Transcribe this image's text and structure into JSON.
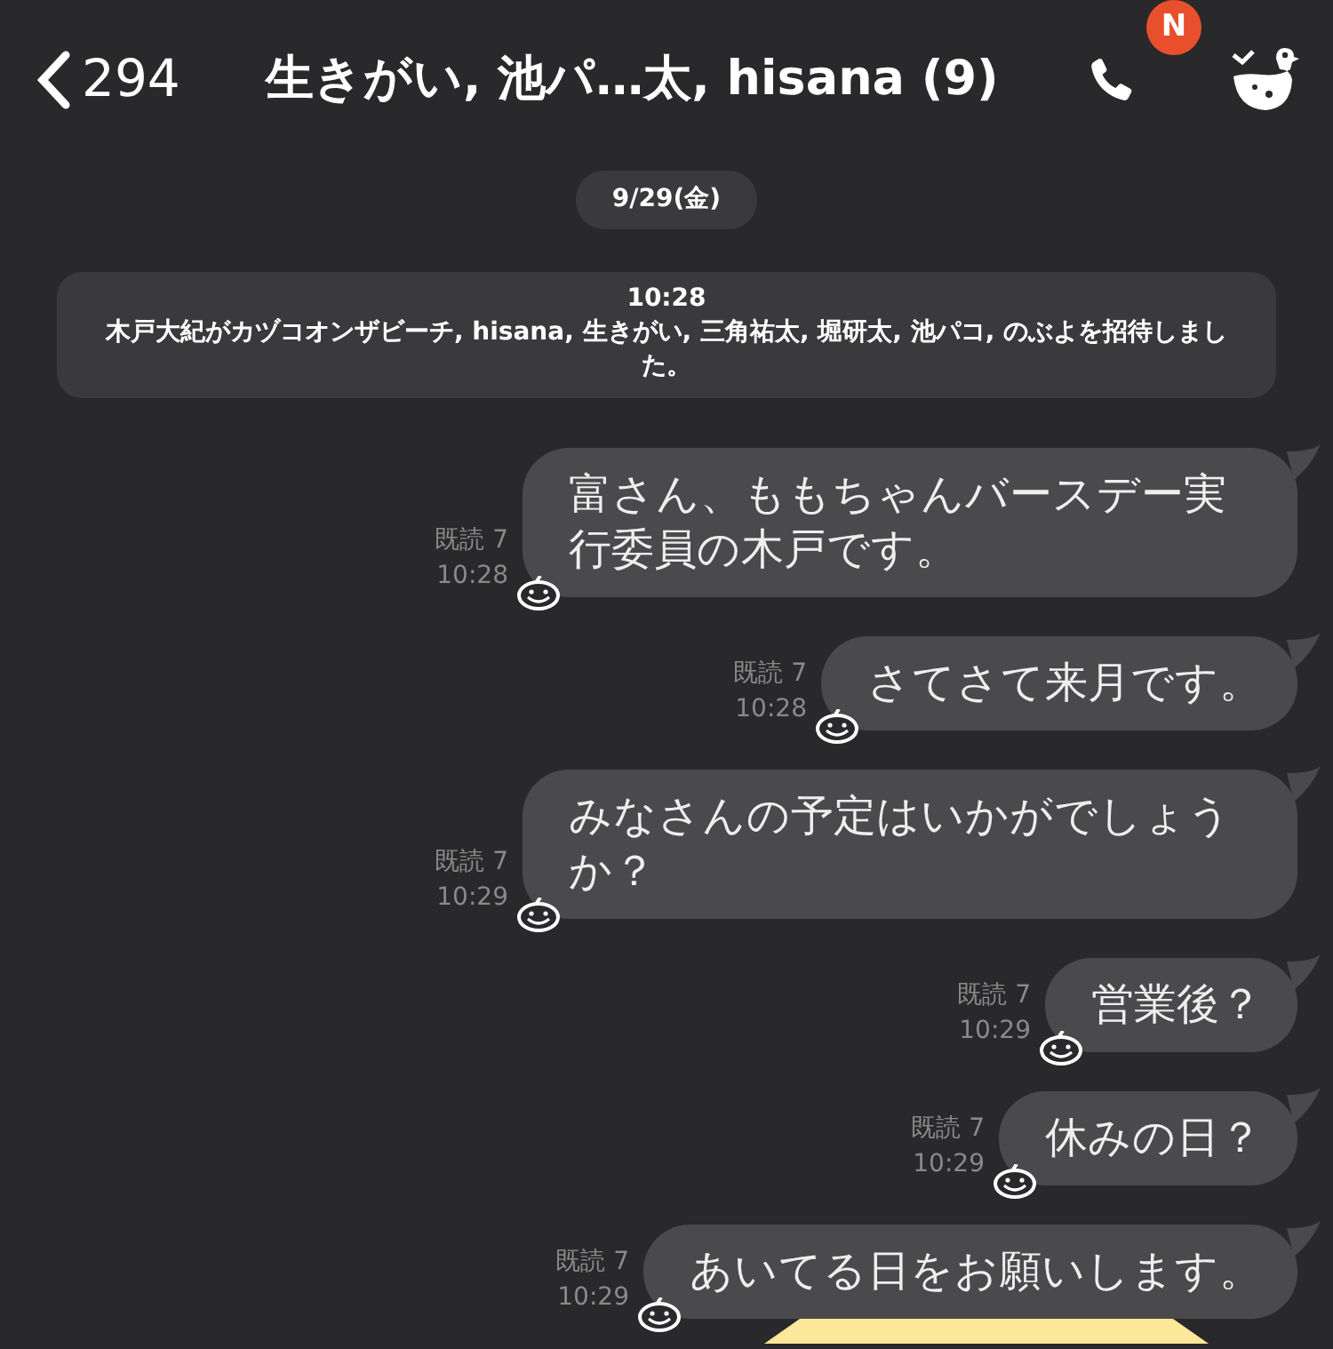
{
  "header": {
    "back_count": "294",
    "title": "生きがい, 池パ…太, hisana (9)",
    "call_badge": "N"
  },
  "date_chip": "9/29(金)",
  "system_message": {
    "time": "10:28",
    "text": "木戸大紀がカヅコオンザビーチ, hisana, 生きがい, 三角祐太, 堀研太, 池パコ, のぶよを招待しました。"
  },
  "messages": [
    {
      "text": "富さん、ももちゃんバースデー実行委員の木戸です。",
      "read": "既読 7",
      "time": "10:28"
    },
    {
      "text": "さてさて来月です。",
      "read": "既読 7",
      "time": "10:28"
    },
    {
      "text": "みなさんの予定はいかがでしょうか？",
      "read": "既読 7",
      "time": "10:29"
    },
    {
      "text": "営業後？",
      "read": "既読 7",
      "time": "10:29"
    },
    {
      "text": "休みの日？",
      "read": "既読 7",
      "time": "10:29"
    },
    {
      "text": "あいてる日をお願いします。",
      "read": "既読 7",
      "time": "10:29"
    }
  ]
}
